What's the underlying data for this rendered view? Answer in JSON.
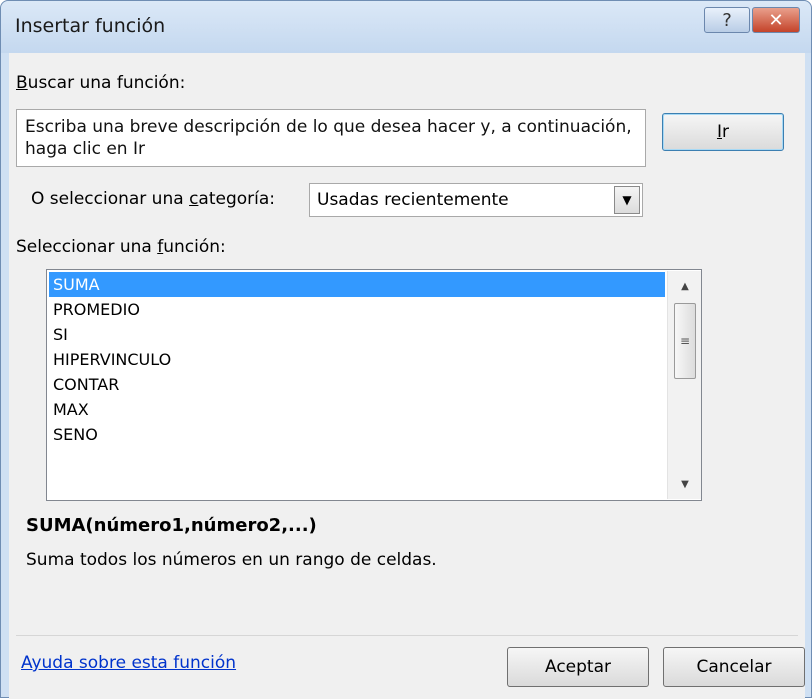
{
  "window": {
    "title": "Insertar función",
    "help_glyph": "?",
    "close_glyph": "✕"
  },
  "search": {
    "label": "Buscar una función:",
    "label_accel": "B",
    "label_rest": "uscar una función:",
    "value": "Escriba una breve descripción de lo que desea hacer y, a continuación, haga clic en Ir",
    "go_label": "Ir",
    "go_accel": "I",
    "go_rest": "r"
  },
  "category": {
    "label_pre": "O seleccionar una ",
    "label_accel": "c",
    "label_post": "ategoría:",
    "selected": "Usadas recientemente",
    "arrow_icon": "chevron-down-icon"
  },
  "functions": {
    "label_pre": "Seleccionar una ",
    "label_accel": "f",
    "label_post": "unción:",
    "items": [
      "SUMA",
      "PROMEDIO",
      "SI",
      "HIPERVINCULO",
      "CONTAR",
      "MAX",
      "SENO"
    ],
    "selected_index": 0
  },
  "details": {
    "signature": "SUMA(número1,número2,...)",
    "description": "Suma todos los números en un rango de celdas."
  },
  "footer": {
    "help_link": "Ayuda sobre esta función",
    "ok_label": "Aceptar",
    "cancel_label": "Cancelar"
  }
}
